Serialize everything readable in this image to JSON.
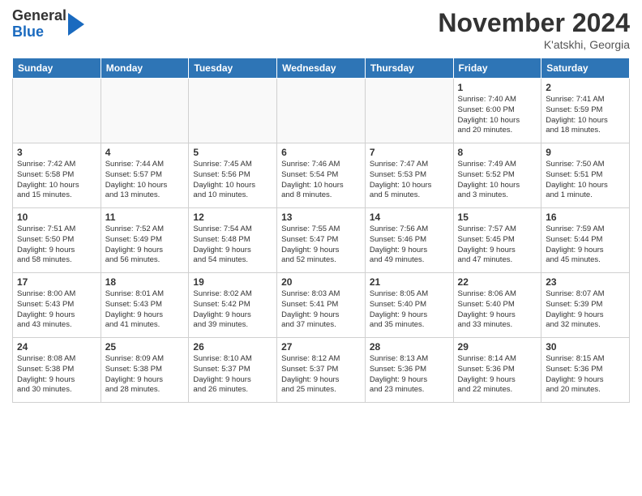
{
  "header": {
    "logo": {
      "general": "General",
      "blue": "Blue"
    },
    "title": "November 2024",
    "location": "K'atskhi, Georgia"
  },
  "weekdays": [
    "Sunday",
    "Monday",
    "Tuesday",
    "Wednesday",
    "Thursday",
    "Friday",
    "Saturday"
  ],
  "weeks": [
    [
      {
        "day": "",
        "info": ""
      },
      {
        "day": "",
        "info": ""
      },
      {
        "day": "",
        "info": ""
      },
      {
        "day": "",
        "info": ""
      },
      {
        "day": "",
        "info": ""
      },
      {
        "day": "1",
        "info": "Sunrise: 7:40 AM\nSunset: 6:00 PM\nDaylight: 10 hours\nand 20 minutes."
      },
      {
        "day": "2",
        "info": "Sunrise: 7:41 AM\nSunset: 5:59 PM\nDaylight: 10 hours\nand 18 minutes."
      }
    ],
    [
      {
        "day": "3",
        "info": "Sunrise: 7:42 AM\nSunset: 5:58 PM\nDaylight: 10 hours\nand 15 minutes."
      },
      {
        "day": "4",
        "info": "Sunrise: 7:44 AM\nSunset: 5:57 PM\nDaylight: 10 hours\nand 13 minutes."
      },
      {
        "day": "5",
        "info": "Sunrise: 7:45 AM\nSunset: 5:56 PM\nDaylight: 10 hours\nand 10 minutes."
      },
      {
        "day": "6",
        "info": "Sunrise: 7:46 AM\nSunset: 5:54 PM\nDaylight: 10 hours\nand 8 minutes."
      },
      {
        "day": "7",
        "info": "Sunrise: 7:47 AM\nSunset: 5:53 PM\nDaylight: 10 hours\nand 5 minutes."
      },
      {
        "day": "8",
        "info": "Sunrise: 7:49 AM\nSunset: 5:52 PM\nDaylight: 10 hours\nand 3 minutes."
      },
      {
        "day": "9",
        "info": "Sunrise: 7:50 AM\nSunset: 5:51 PM\nDaylight: 10 hours\nand 1 minute."
      }
    ],
    [
      {
        "day": "10",
        "info": "Sunrise: 7:51 AM\nSunset: 5:50 PM\nDaylight: 9 hours\nand 58 minutes."
      },
      {
        "day": "11",
        "info": "Sunrise: 7:52 AM\nSunset: 5:49 PM\nDaylight: 9 hours\nand 56 minutes."
      },
      {
        "day": "12",
        "info": "Sunrise: 7:54 AM\nSunset: 5:48 PM\nDaylight: 9 hours\nand 54 minutes."
      },
      {
        "day": "13",
        "info": "Sunrise: 7:55 AM\nSunset: 5:47 PM\nDaylight: 9 hours\nand 52 minutes."
      },
      {
        "day": "14",
        "info": "Sunrise: 7:56 AM\nSunset: 5:46 PM\nDaylight: 9 hours\nand 49 minutes."
      },
      {
        "day": "15",
        "info": "Sunrise: 7:57 AM\nSunset: 5:45 PM\nDaylight: 9 hours\nand 47 minutes."
      },
      {
        "day": "16",
        "info": "Sunrise: 7:59 AM\nSunset: 5:44 PM\nDaylight: 9 hours\nand 45 minutes."
      }
    ],
    [
      {
        "day": "17",
        "info": "Sunrise: 8:00 AM\nSunset: 5:43 PM\nDaylight: 9 hours\nand 43 minutes."
      },
      {
        "day": "18",
        "info": "Sunrise: 8:01 AM\nSunset: 5:43 PM\nDaylight: 9 hours\nand 41 minutes."
      },
      {
        "day": "19",
        "info": "Sunrise: 8:02 AM\nSunset: 5:42 PM\nDaylight: 9 hours\nand 39 minutes."
      },
      {
        "day": "20",
        "info": "Sunrise: 8:03 AM\nSunset: 5:41 PM\nDaylight: 9 hours\nand 37 minutes."
      },
      {
        "day": "21",
        "info": "Sunrise: 8:05 AM\nSunset: 5:40 PM\nDaylight: 9 hours\nand 35 minutes."
      },
      {
        "day": "22",
        "info": "Sunrise: 8:06 AM\nSunset: 5:40 PM\nDaylight: 9 hours\nand 33 minutes."
      },
      {
        "day": "23",
        "info": "Sunrise: 8:07 AM\nSunset: 5:39 PM\nDaylight: 9 hours\nand 32 minutes."
      }
    ],
    [
      {
        "day": "24",
        "info": "Sunrise: 8:08 AM\nSunset: 5:38 PM\nDaylight: 9 hours\nand 30 minutes."
      },
      {
        "day": "25",
        "info": "Sunrise: 8:09 AM\nSunset: 5:38 PM\nDaylight: 9 hours\nand 28 minutes."
      },
      {
        "day": "26",
        "info": "Sunrise: 8:10 AM\nSunset: 5:37 PM\nDaylight: 9 hours\nand 26 minutes."
      },
      {
        "day": "27",
        "info": "Sunrise: 8:12 AM\nSunset: 5:37 PM\nDaylight: 9 hours\nand 25 minutes."
      },
      {
        "day": "28",
        "info": "Sunrise: 8:13 AM\nSunset: 5:36 PM\nDaylight: 9 hours\nand 23 minutes."
      },
      {
        "day": "29",
        "info": "Sunrise: 8:14 AM\nSunset: 5:36 PM\nDaylight: 9 hours\nand 22 minutes."
      },
      {
        "day": "30",
        "info": "Sunrise: 8:15 AM\nSunset: 5:36 PM\nDaylight: 9 hours\nand 20 minutes."
      }
    ]
  ]
}
